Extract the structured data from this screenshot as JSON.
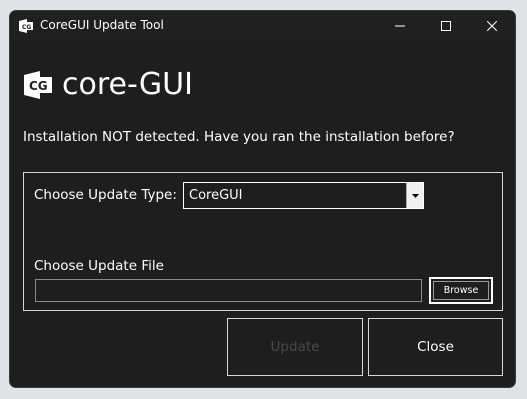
{
  "window": {
    "title": "CoreGUI Update Tool",
    "icon": "coregui-logo-icon",
    "controls": {
      "minimize": "minimize-icon",
      "maximize": "maximize-icon",
      "close": "close-icon"
    }
  },
  "brand": {
    "logo_letters": "CG",
    "name": "core-GUI"
  },
  "status": {
    "message": "Installation NOT detected. Have you ran the installation before?"
  },
  "form": {
    "update_type_label": "Choose Update Type:",
    "update_type_value": "CoreGUI",
    "update_file_label": "Choose Update File",
    "update_file_value": "",
    "browse_label": "Browse"
  },
  "actions": {
    "update_label": "Update",
    "update_enabled": false,
    "close_label": "Close"
  },
  "colors": {
    "window_bg": "#1e1e1e",
    "titlebar_bg": "#202020",
    "border": "#d6d6d6",
    "text": "#ffffff",
    "disabled_text": "#4a4a4a"
  }
}
